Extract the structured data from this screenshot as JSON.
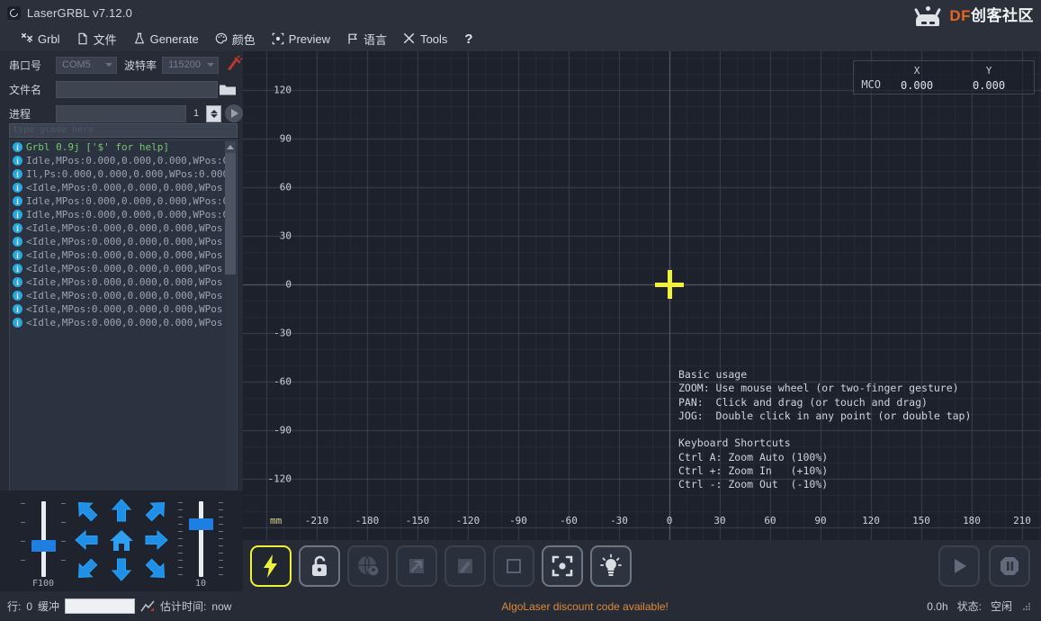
{
  "window": {
    "title": "LaserGRBL v7.12.0",
    "logo_icon": "lasergrbl-logo-icon"
  },
  "brand": {
    "name_prefix": "DF",
    "name_cn": "创客社区",
    "url": "mc.DFRobot.com.cn"
  },
  "menu": [
    {
      "label": "Grbl",
      "icon": "wrench-icon"
    },
    {
      "label": "文件",
      "icon": "file-icon"
    },
    {
      "label": "Generate",
      "icon": "flask-icon"
    },
    {
      "label": "颜色",
      "icon": "palette-icon"
    },
    {
      "label": "Preview",
      "icon": "preview-icon"
    },
    {
      "label": "语言",
      "icon": "flag-icon"
    },
    {
      "label": "Tools",
      "icon": "tools-icon"
    },
    {
      "label": "?",
      "icon": "help-icon"
    }
  ],
  "connection": {
    "port_label": "串口号",
    "port_value": "COM5",
    "baud_label": "波特率",
    "baud_value": "115200",
    "disconnect_icon": "disconnect-icon"
  },
  "file": {
    "label": "文件名",
    "value": "",
    "browse_icon": "folder-icon"
  },
  "progress": {
    "label": "进程",
    "value": "",
    "repeat_count": "1",
    "run_icon": "play-icon"
  },
  "gcode_input": {
    "placeholder": "type gcode here"
  },
  "console": {
    "lines": [
      {
        "text": "Grbl 0.9j ['$' for help]",
        "kind": "boot"
      },
      {
        "text": "Idle,MPos:0.000,0.000,0.000,WPos:0…",
        "kind": "status"
      },
      {
        "text": "Il,Ps:0.000,0.000,0.000,WPos:0.000…",
        "kind": "status"
      },
      {
        "text": "<Idle,MPos:0.000,0.000,0.000,WPos:…",
        "kind": "status"
      },
      {
        "text": "Idle,MPos:0.000,0.000,0.000,WPos:0…",
        "kind": "status"
      },
      {
        "text": "Idle,MPos:0.000,0.000,0.000,WPos:0…",
        "kind": "status"
      },
      {
        "text": "<Idle,MPos:0.000,0.000,0.000,WPos:…",
        "kind": "status"
      },
      {
        "text": "<Idle,MPos:0.000,0.000,0.000,WPos:…",
        "kind": "status"
      },
      {
        "text": "<Idle,MPos:0.000,0.000,0.000,WPos:…",
        "kind": "status"
      },
      {
        "text": "<Idle,MPos:0.000,0.000,0.000,WPos:…",
        "kind": "status"
      },
      {
        "text": "<Idle,MPos:0.000,0.000,0.000,WPos:…",
        "kind": "status"
      },
      {
        "text": "<Idle,MPos:0.000,0.000,0.000,WPos:…",
        "kind": "status"
      },
      {
        "text": "<Idle,MPos:0.000,0.000,0.000,WPos:…",
        "kind": "status"
      },
      {
        "text": "<Idle,MPos:0.000,0.000,0.000,WPos:…",
        "kind": "status"
      }
    ]
  },
  "jog": {
    "feed_slider_label": "F100",
    "step_slider_label": "10",
    "buttons": [
      "jog-up-left",
      "jog-up",
      "jog-up-right",
      "jog-left",
      "jog-home",
      "jog-right",
      "jog-down-left",
      "jog-down",
      "jog-down-right"
    ]
  },
  "mco": {
    "label": "MCO",
    "x_header": "X",
    "y_header": "Y",
    "x_value": "0.000",
    "y_value": "0.000"
  },
  "help_overlay": {
    "lines": [
      "Basic usage",
      "ZOOM: Use mouse wheel (or two-finger gesture)",
      "PAN:  Click and drag (or touch and drag)",
      "JOG:  Double click in any point (or double tap)",
      "",
      "Keyboard Shortcuts",
      "Ctrl A: Zoom Auto (100%)",
      "Ctrl +: Zoom In   (+10%)",
      "Ctrl -: Zoom Out  (-10%)"
    ]
  },
  "chart_data": {
    "type": "scatter",
    "title": "",
    "xlabel": "mm",
    "ylabel": "",
    "xlim": [
      -225,
      222
    ],
    "ylim": [
      -135,
      135
    ],
    "xticks": [
      -210,
      -180,
      -150,
      -120,
      -90,
      -60,
      -30,
      0,
      30,
      60,
      90,
      120,
      150,
      180,
      210
    ],
    "yticks": [
      120,
      90,
      60,
      30,
      0,
      -30,
      -60,
      -90,
      -120
    ],
    "grid": true,
    "major_step": 30,
    "minor_step": 10,
    "points": [
      {
        "x": 0,
        "y": 0,
        "marker": "crosshair",
        "color": "#f2f23a"
      }
    ],
    "units": "mm"
  },
  "toolbar": {
    "buttons": [
      {
        "name": "laser-power-button",
        "icon": "lightning-icon",
        "state": "active"
      },
      {
        "name": "unlock-button",
        "icon": "unlock-icon",
        "state": "enabled"
      },
      {
        "name": "return-home-button",
        "icon": "globe-pin-icon",
        "state": "disabled"
      },
      {
        "name": "set-origin-button",
        "icon": "arrow-out-icon",
        "state": "disabled"
      },
      {
        "name": "engrave-point-button",
        "icon": "pencil-icon",
        "state": "disabled"
      },
      {
        "name": "frame-loop-button",
        "icon": "loop-arrows-icon",
        "state": "disabled"
      },
      {
        "name": "focus-button",
        "icon": "focus-target-icon",
        "state": "enabled"
      },
      {
        "name": "light-button",
        "icon": "lightbulb-icon",
        "state": "enabled"
      }
    ],
    "play": {
      "name": "play-button",
      "icon": "play-icon",
      "state": "disabled"
    },
    "pause": {
      "name": "pause-button",
      "icon": "pause-icon",
      "state": "disabled"
    }
  },
  "statusbar": {
    "line_label": "行:",
    "line_value": "0",
    "buffer_label": "缓冲",
    "eta_label": "估计时间:",
    "eta_value": "now",
    "promo": "AlgoLaser discount code available!",
    "runtime": "0.0h",
    "state_label": "状态:",
    "state_value": "空闲"
  }
}
